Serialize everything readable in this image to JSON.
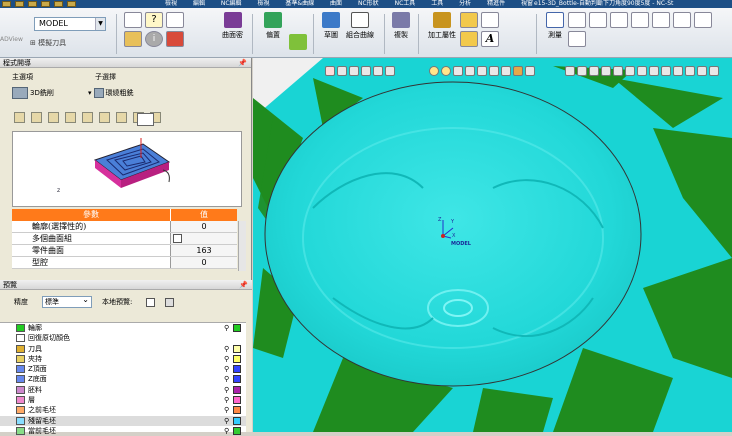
{
  "window": {
    "menus": [
      "檢視",
      "編輯",
      "NC編輯",
      "檢視",
      "基準&曲線",
      "曲面",
      "NC形狀",
      "NC工具",
      "工具",
      "分析",
      "精進件",
      "視窗"
    ],
    "document_title": "e15-3D_Bottle-自動判斷下刀角度90度5度 - NC-St"
  },
  "ribbon": {
    "model_select": "MODEL",
    "ad_view": "ADView",
    "tool_clip_label": "模擬刀具",
    "groups": [
      {
        "label": "曲面密",
        "icon": "surface-density-icon",
        "color": "#7a3c96"
      },
      {
        "label": "偏置",
        "icon": "offset-icon",
        "color": "#33a35a"
      },
      {
        "label": "草圖",
        "icon": "sketch-icon",
        "color": "#3c7ac8"
      },
      {
        "label": "組合曲線",
        "icon": "composite-curve-icon",
        "color": "#555555"
      },
      {
        "label": "複製",
        "icon": "copy-icon",
        "color": "#7a7aa8"
      },
      {
        "label": "加工屬性",
        "icon": "machining-attr-icon",
        "color": "#c8941e"
      },
      {
        "label": "測量",
        "icon": "measure-icon",
        "color": "#4466aa"
      }
    ]
  },
  "left_panel": {
    "title": "程式開導",
    "main_label": "主選項",
    "sub_label": "子選擇",
    "main_item": "3D銑削",
    "sub_item": "環繞粗銑",
    "param_header_name": "參數",
    "param_header_value": "值",
    "params": [
      {
        "name": "輪廓(選擇性的)",
        "value": "0"
      },
      {
        "name": "多個曲面組",
        "value": ""
      },
      {
        "name": "零件曲面",
        "value": "163"
      },
      {
        "name": "型腔",
        "value": "0"
      }
    ]
  },
  "overview": {
    "title": "預覽",
    "level_label": "精度",
    "level_value": "標準",
    "local_preview_label": "本地預覽:",
    "items": [
      {
        "label": "輪廓",
        "color": "#22cc22"
      },
      {
        "label": "回復原切顏色",
        "color": "#ffffff"
      },
      {
        "label": "刀具",
        "color": "#ffffaa"
      },
      {
        "label": "夾持",
        "color": "#ffff66"
      },
      {
        "label": "Z頂面",
        "color": "#3344ff"
      },
      {
        "label": "Z底面",
        "color": "#3344ff"
      },
      {
        "label": "胚料",
        "color": "#aa22aa"
      },
      {
        "label": "層",
        "color": "#ff66cc"
      },
      {
        "label": "之前毛坯",
        "color": "#ff8844"
      },
      {
        "label": "殘留毛坯",
        "color": "#33ccff"
      },
      {
        "label": "當前毛坯",
        "color": "#33cc33"
      }
    ]
  },
  "viewport": {
    "model_label": "MODEL",
    "axis_x": "X",
    "axis_y": "Y",
    "axis_z": "Z",
    "background_color": "#19d4d4",
    "green_color": "#1f8c1f"
  }
}
